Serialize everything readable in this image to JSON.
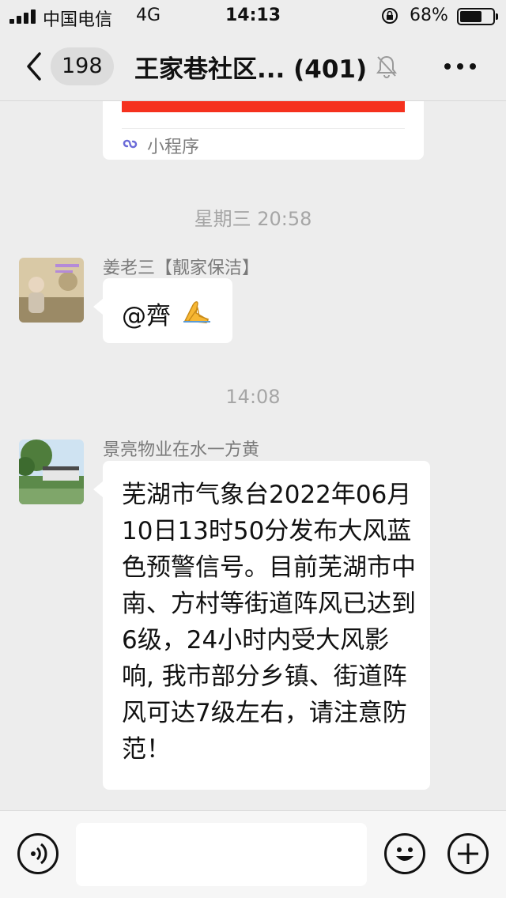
{
  "status_bar": {
    "carrier": "中国电信",
    "network": "4G",
    "time": "14:13",
    "battery_percent": "68%",
    "battery_level": 0.68
  },
  "nav": {
    "unread_count": "198",
    "chat_title": "王家巷社区... (401)"
  },
  "mini_program": {
    "label": "小程序",
    "accent_color": "#f5311e"
  },
  "messages": [
    {
      "timestamp": "星期三 20:58",
      "sender": "姜老三【靓家保洁】",
      "text": "@齊"
    },
    {
      "timestamp": "14:08",
      "sender": "景亮物业在水一方黄",
      "text": "芜湖市气象台2022年06月10日13时50分发布大风蓝色预警信号。目前芜湖市中南、方村等街道阵风已达到6级，24小时内受大风影响, 我市部分乡镇、街道阵风可达7级左右，请注意防范！"
    }
  ],
  "icons": {
    "back": "chevron-left-icon",
    "mute": "bell-slash-icon",
    "more": "ellipsis-icon",
    "voice": "voice-icon",
    "emoji": "smiley-icon",
    "plus": "plus-icon",
    "mini_program": "link-icon",
    "lock": "rotation-lock-icon",
    "praying_hands": "praying-hands-emoji"
  },
  "input": {
    "placeholder": ""
  }
}
